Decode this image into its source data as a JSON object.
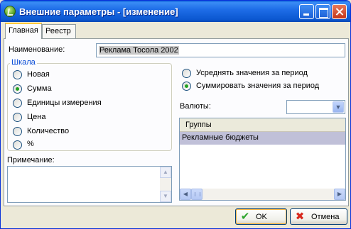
{
  "window": {
    "title": "Внешние параметры - [изменение]",
    "icons": {
      "app": "app-logo-icon",
      "minimize": "minimize-icon",
      "maximize": "maximize-icon",
      "close": "close-icon"
    }
  },
  "tabs": [
    {
      "label": "Главная",
      "active": true
    },
    {
      "label": "Реестр",
      "active": false
    }
  ],
  "form": {
    "name_label": "Наименование:",
    "name_value": "Реклама Тосола 2002",
    "scale": {
      "legend": "Шкала",
      "options": [
        {
          "label": "Новая",
          "checked": false
        },
        {
          "label": "Сумма",
          "checked": true
        },
        {
          "label": "Единицы измерения",
          "checked": false
        },
        {
          "label": "Цена",
          "checked": false
        },
        {
          "label": "Количество",
          "checked": false
        },
        {
          "label": "%",
          "checked": false
        }
      ]
    },
    "period": {
      "options": [
        {
          "label": "Усреднять значения за период",
          "checked": false
        },
        {
          "label": "Суммировать значения за период",
          "checked": true
        }
      ]
    },
    "currency_label": "Валюты:",
    "currency_value": "",
    "note_label": "Примечание:",
    "note_value": "",
    "groups": {
      "header": "Группы",
      "rows": [
        "Рекламные бюджеты"
      ]
    }
  },
  "buttons": {
    "ok": "OK",
    "cancel": "Отмена"
  },
  "colors": {
    "title_bar": "#0b57d0",
    "group_legend": "#0046d5",
    "selected_row": "#c0c0d8"
  }
}
